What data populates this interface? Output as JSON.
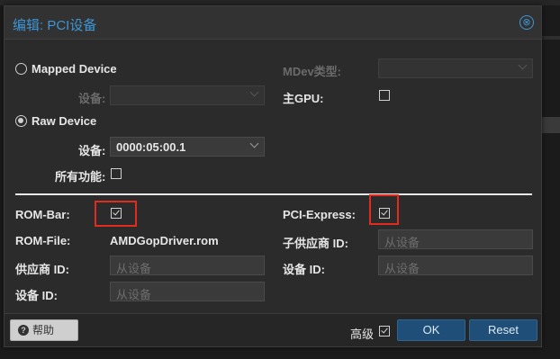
{
  "dialog": {
    "title": "编辑: PCI设备",
    "close_glyph": "⊗"
  },
  "mapped": {
    "radio_label": "Mapped Device",
    "selected": false,
    "device_label": "设备:",
    "device_value": ""
  },
  "mdev": {
    "type_label": "MDev类型:",
    "type_value": "",
    "primary_gpu_label": "主GPU:",
    "primary_gpu_checked": false
  },
  "raw": {
    "radio_label": "Raw Device",
    "selected": true,
    "device_label": "设备:",
    "device_value": "0000:05:00.1",
    "all_functions_label": "所有功能:",
    "all_functions_checked": false
  },
  "advanced": {
    "rombar_label": "ROM-Bar:",
    "rombar_checked": true,
    "pcie_label": "PCI-Express:",
    "pcie_checked": true,
    "romfile_label": "ROM-File:",
    "romfile_value": "AMDGopDriver.rom",
    "sub_vendor_label": "子供应商 ID:",
    "sub_vendor_placeholder": "从设备",
    "vendor_label": "供应商 ID:",
    "vendor_placeholder": "从设备",
    "device_id_label": "设备 ID:",
    "device_id_placeholder": "从设备",
    "sub_device_placeholder": "从设备"
  },
  "footer": {
    "help_label": "帮助",
    "advanced_label": "高级",
    "advanced_checked": true,
    "ok_label": "OK",
    "reset_label": "Reset"
  },
  "colors": {
    "accent": "#3d96d6",
    "highlight": "#e22b1f",
    "primary_button": "#1f4f78"
  }
}
